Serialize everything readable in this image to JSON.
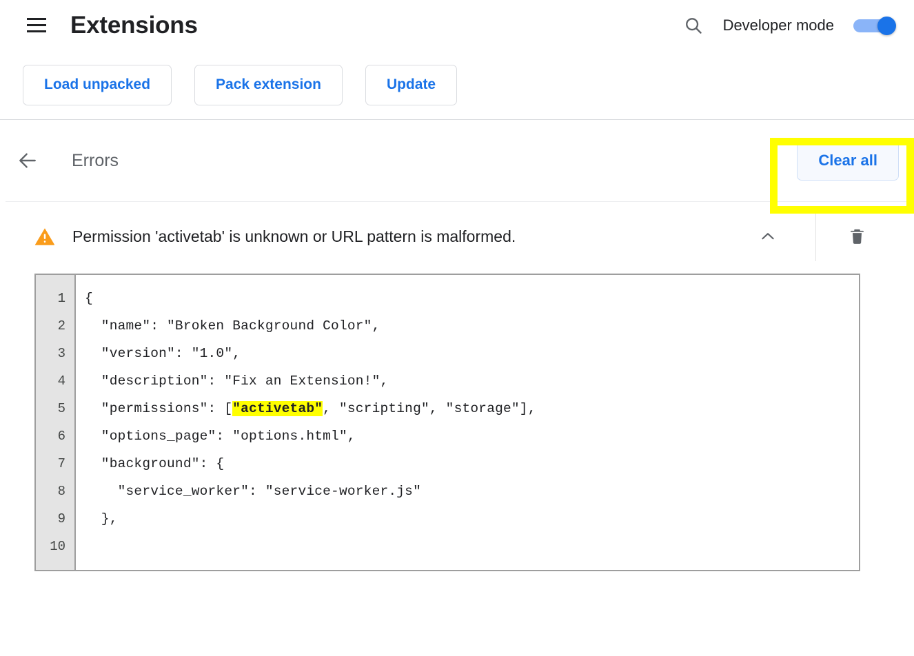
{
  "header": {
    "menu_icon": "hamburger-menu-icon",
    "title": "Extensions",
    "search_icon": "search-icon",
    "developer_mode_label": "Developer mode",
    "developer_mode_on": true,
    "toggle_accent": "#1a73e8",
    "toggle_track": "#8ab4f8"
  },
  "toolbar": {
    "buttons": [
      {
        "label": "Load unpacked"
      },
      {
        "label": "Pack extension"
      },
      {
        "label": "Update"
      }
    ],
    "accent": "#1a73e8"
  },
  "errors_page": {
    "back_icon": "back-arrow-icon",
    "title": "Errors",
    "clear_all_label": "Clear all",
    "highlight_color": "#ffff00"
  },
  "error_item": {
    "severity_icon": "warning-triangle-icon",
    "severity_color": "#fa9c1b",
    "message": "Permission 'activetab' is unknown or URL pattern is malformed.",
    "collapse_icon": "chevron-up-icon",
    "delete_icon": "trash-icon",
    "expanded": true
  },
  "code_block": {
    "line_numbers": [
      "1",
      "2",
      "3",
      "4",
      "5",
      "6",
      "7",
      "8",
      "9",
      "10"
    ],
    "lines": [
      {
        "text": "{"
      },
      {
        "text": "  \"name\": \"Broken Background Color\","
      },
      {
        "text": "  \"version\": \"1.0\","
      },
      {
        "text": "  \"description\": \"Fix an Extension!\","
      },
      {
        "pre": "  \"permissions\": [",
        "highlight": "\"activetab\"",
        "post": ", \"scripting\", \"storage\"],"
      },
      {
        "text": "  \"options_page\": \"options.html\","
      },
      {
        "text": "  \"background\": {"
      },
      {
        "text": "    \"service_worker\": \"service-worker.js\""
      },
      {
        "text": "  },"
      },
      {
        "text": ""
      }
    ],
    "highlight_color": "#ffff00"
  }
}
